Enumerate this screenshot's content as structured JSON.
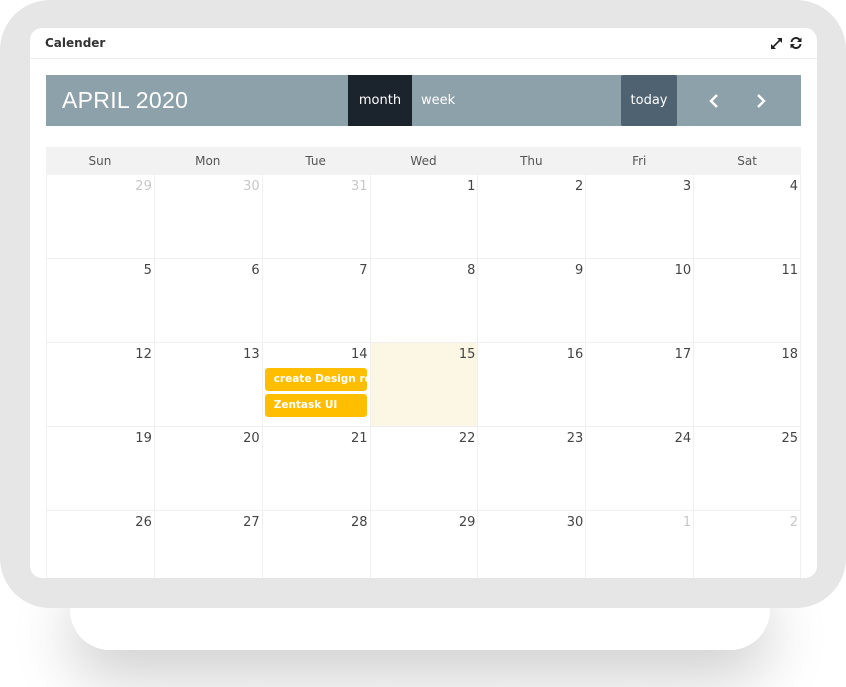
{
  "panel": {
    "title": "Calender",
    "tools": [
      {
        "icon": "expand-icon"
      },
      {
        "icon": "refresh-icon"
      }
    ]
  },
  "toolbar": {
    "title": "APRIL 2020",
    "month_label": "month",
    "week_label": "week",
    "today_label": "today",
    "prev_label": "‹",
    "next_label": "›",
    "active_view": "month"
  },
  "calendar": {
    "weekdays": [
      "Sun",
      "Mon",
      "Tue",
      "Wed",
      "Thu",
      "Fri",
      "Sat"
    ],
    "today": 15,
    "weeks": [
      [
        {
          "d": "29",
          "other": true
        },
        {
          "d": "30",
          "other": true
        },
        {
          "d": "31",
          "other": true
        },
        {
          "d": "1"
        },
        {
          "d": "2"
        },
        {
          "d": "3"
        },
        {
          "d": "4"
        }
      ],
      [
        {
          "d": "5"
        },
        {
          "d": "6"
        },
        {
          "d": "7"
        },
        {
          "d": "8"
        },
        {
          "d": "9"
        },
        {
          "d": "10"
        },
        {
          "d": "11"
        }
      ],
      [
        {
          "d": "12"
        },
        {
          "d": "13"
        },
        {
          "d": "14",
          "events": [
            "create Design re",
            "Zentask UI"
          ]
        },
        {
          "d": "15",
          "today": true
        },
        {
          "d": "16"
        },
        {
          "d": "17"
        },
        {
          "d": "18"
        }
      ],
      [
        {
          "d": "19"
        },
        {
          "d": "20"
        },
        {
          "d": "21"
        },
        {
          "d": "22"
        },
        {
          "d": "23"
        },
        {
          "d": "24"
        },
        {
          "d": "25"
        }
      ],
      [
        {
          "d": "26"
        },
        {
          "d": "27"
        },
        {
          "d": "28"
        },
        {
          "d": "29"
        },
        {
          "d": "30"
        },
        {
          "d": "1",
          "other": true
        },
        {
          "d": "2",
          "other": true
        }
      ]
    ]
  },
  "colors": {
    "toolbar_bg": "#8da1aa",
    "active_view_bg": "#1b232d",
    "today_button_bg": "#4f6271",
    "event_bg": "#ffbf00",
    "today_cell_bg": "#fcf7e4"
  }
}
